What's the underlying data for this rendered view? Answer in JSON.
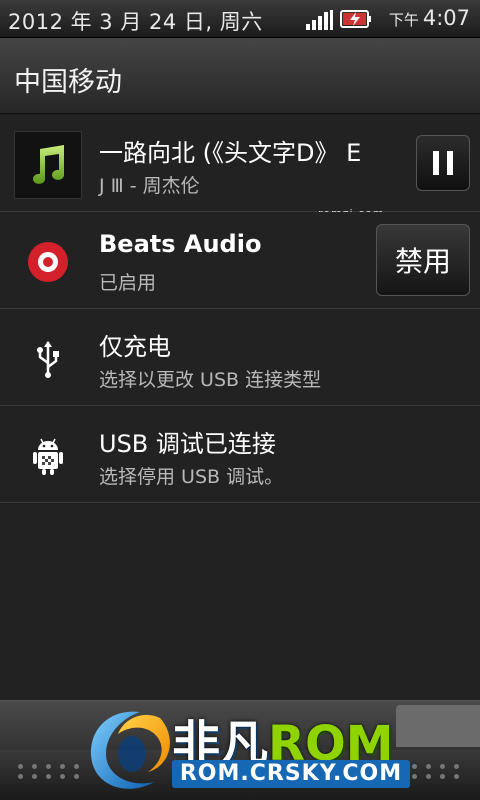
{
  "status_bar": {
    "date": "2012 年 3 月 24 日, 周六",
    "ampm": "下午",
    "time": "4:07",
    "icons": [
      "signal-icon",
      "battery-charging-icon"
    ]
  },
  "carrier": {
    "name": "中国移动"
  },
  "notifications": [
    {
      "id": "music",
      "title": "一路向北 (《头文字D》 E",
      "subtitle": "J Ⅲ - 周杰伦",
      "icon": "music-note-icon",
      "action": "pause"
    },
    {
      "id": "beats",
      "title": "Beats Audio",
      "subtitle": "已启用",
      "icon": "beats-logo-icon",
      "action_label": "禁用"
    },
    {
      "id": "charge",
      "title": "仅充电",
      "subtitle": "选择以更改 USB 连接类型",
      "icon": "usb-icon"
    },
    {
      "id": "debug",
      "title": "USB 调试已连接",
      "subtitle": "选择停用 USB 调试。",
      "icon": "android-debug-icon"
    }
  ],
  "watermark": "romzj.com",
  "logo": {
    "brand_text": "非凡",
    "brand_rom": "ROM",
    "site": "ROM.CRSKY.COM"
  },
  "colors": {
    "beats_red": "#d3202a",
    "music_green": "#8cc63f",
    "logo_green": "#8fd400",
    "logo_blue": "#1667b4"
  }
}
